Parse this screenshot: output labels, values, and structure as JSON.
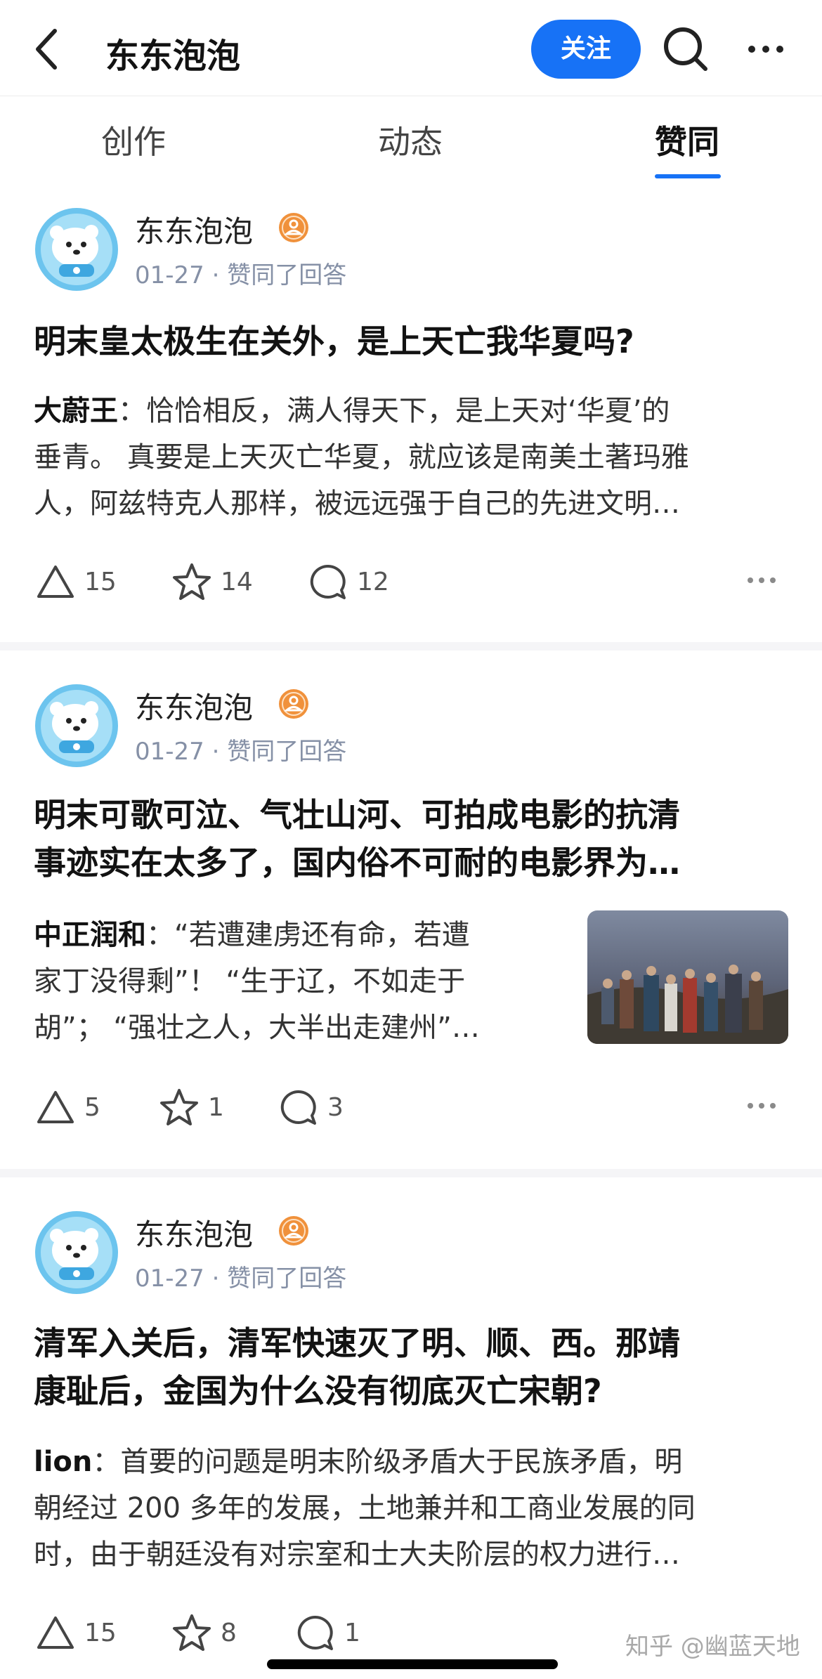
{
  "header": {
    "title": "东东泡泡",
    "follow_label": "关注"
  },
  "tabs": [
    {
      "label": "创作"
    },
    {
      "label": "动态"
    },
    {
      "label": "赞同"
    }
  ],
  "cards": [
    {
      "user": "东东泡泡",
      "meta": "01-27 · 赞同了回答",
      "title_lines": [
        "明末皇太极生在关外，是上天亡我华夏吗?"
      ],
      "author": "大蔚王",
      "excerpt_lines": [
        "：恰恰相反，满人得天下，是上天对‘华夏’的",
        "垂青。 真要是上天灭亡华夏，就应该是南美土著玛雅",
        "人，阿兹特克人那样，被远远强于自己的先进文明…"
      ],
      "upvotes": "15",
      "stars": "14",
      "comments": "12"
    },
    {
      "user": "东东泡泡",
      "meta": "01-27 · 赞同了回答",
      "title_lines": [
        "明末可歌可泣、气壮山河、可拍成电影的抗清",
        "事迹实在太多了，国内俗不可耐的电影界为…"
      ],
      "author": "中正润和",
      "excerpt_lines": [
        "：“若遭建虏还有命，若遭",
        "家丁没得剩”！ “生于辽，不如走于",
        "胡”； “强壮之人，大半出走建州”…"
      ],
      "upvotes": "5",
      "stars": "1",
      "comments": "3"
    },
    {
      "user": "东东泡泡",
      "meta": "01-27 · 赞同了回答",
      "title_lines": [
        "清军入关后，清军快速灭了明、顺、西。那靖",
        "康耻后，金国为什么没有彻底灭亡宋朝?"
      ],
      "author": "lion",
      "excerpt_lines": [
        "：首要的问题是明末阶级矛盾大于民族矛盾，明",
        "朝经过 200 多年的发展，土地兼并和工商业发展的同",
        "时，由于朝廷没有对宗室和士大夫阶层的权力进行…"
      ],
      "upvotes": "15",
      "stars": "8",
      "comments": "1"
    }
  ],
  "watermark": "知乎 @幽蓝天地",
  "colors": {
    "accent": "#1772f6",
    "meta_gray": "#8590a6"
  }
}
